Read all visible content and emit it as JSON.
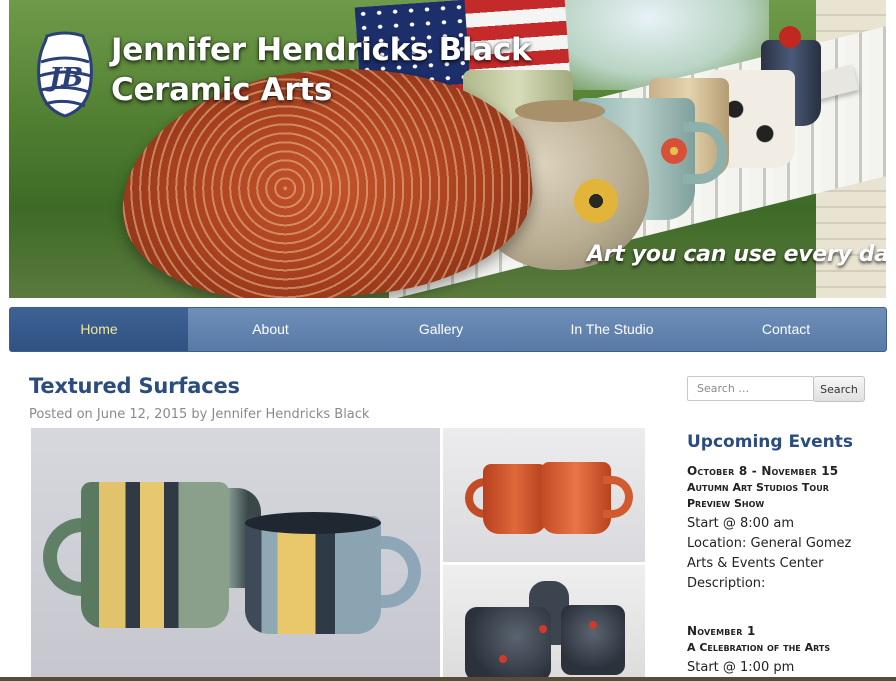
{
  "site": {
    "title_line1": "Jennifer Hendricks Black",
    "title_line2": "Ceramic Arts",
    "tagline": "Art you can use every day",
    "logo_icon": "jhb-monogram-vase-icon"
  },
  "nav": {
    "items": [
      {
        "label": "Home",
        "active": true
      },
      {
        "label": "About"
      },
      {
        "label": "Gallery"
      },
      {
        "label": "In The Studio"
      },
      {
        "label": "Contact"
      }
    ],
    "active_color": "#f4e79a",
    "bar_color": "#577aa6"
  },
  "post": {
    "title": "Textured Surfaces",
    "meta_prefix": "Posted on",
    "date": "June 12, 2015",
    "meta_by": "by",
    "author": "Jennifer Hendricks Black"
  },
  "search": {
    "placeholder": "Search …",
    "button_label": "Search"
  },
  "events": {
    "title": "Upcoming Events",
    "items": [
      {
        "date": "October 8 - November 15",
        "name_line1": "Autumn Art Studios Tour",
        "name_line2": "Preview Show",
        "start": "Start @ 8:00 am",
        "location_line1": "Location: General Gomez",
        "location_line2": "Arts & Events Center",
        "description": "Description:"
      },
      {
        "date": "November 1",
        "name_line1": "A Celebration of the Arts",
        "start": "Start @ 1:00 pm"
      }
    ]
  },
  "colors": {
    "heading": "#2b4d7e",
    "meta": "#8a8a8a"
  }
}
